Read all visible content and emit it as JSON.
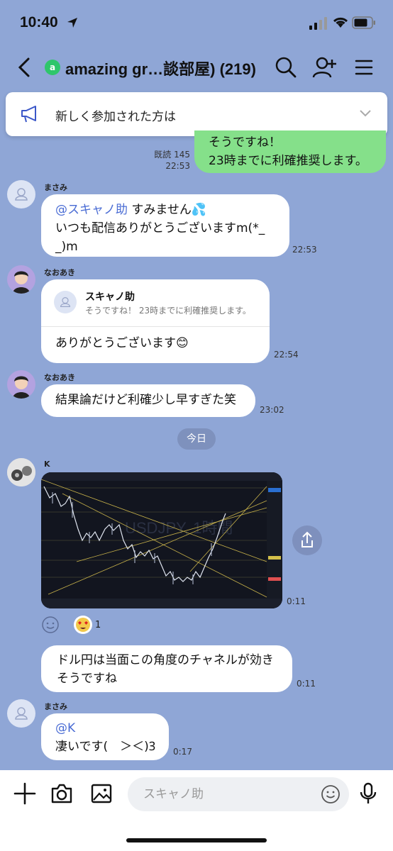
{
  "status": {
    "time": "10:40"
  },
  "header": {
    "title": "amazing gr…談部屋) (219)"
  },
  "announcement": {
    "text": "新しく参加された方は"
  },
  "messages": {
    "m1": {
      "line1": "そうですね！",
      "line2": "23時までに利確推奨します。",
      "read": "既読 145",
      "time": "22:53"
    },
    "m2": {
      "sender": "まさみ",
      "mention": "@スキャノ助",
      "line1_rest": " すみません💦",
      "line2": "いつも配信ありがとうございますm(*_",
      "line3": "_)m",
      "time": "22:53"
    },
    "m3": {
      "sender": "なおあき",
      "reply_name": "スキャノ助",
      "reply_text": "そうですね！ 23時までに利確推奨します。",
      "text": "ありがとうございます😊",
      "time": "22:54"
    },
    "m4": {
      "sender": "なおあき",
      "text": "結果論だけど利確少し早すぎた笑",
      "time": "23:02"
    },
    "date_label": "今日",
    "m5": {
      "sender": "K",
      "time": "0:11",
      "reaction_count": "1",
      "chart_watermark": "USDJPY, 1時間"
    },
    "m6": {
      "line1": "ドル円は当面この角度のチャネルが効き",
      "line2": "そうですね",
      "time": "0:11"
    },
    "m7": {
      "sender": "まさみ",
      "mention": "@K",
      "line2": "凄いです(　＞＜)Ꝫ",
      "time": "0:17"
    }
  },
  "input": {
    "placeholder": "スキャノ助"
  },
  "colors": {
    "background": "#8fa6d6",
    "my_bubble": "#85e08a",
    "mention": "#4a6cd4"
  }
}
